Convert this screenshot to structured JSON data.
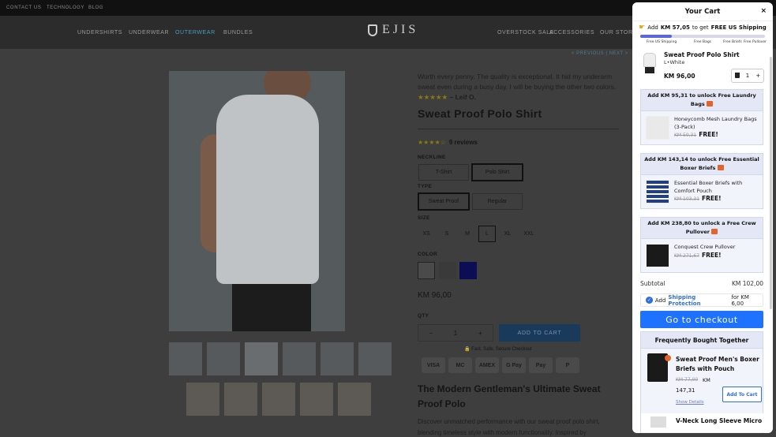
{
  "topbar": {
    "links": [
      "CONTACT US",
      "TECHNOLOGY",
      "BLOG"
    ]
  },
  "nav": {
    "left": [
      "UNDERSHIRTS",
      "UNDERWEAR",
      "OUTERWEAR",
      "BUNDLES"
    ],
    "logo": "EJIS",
    "right": [
      "OVERSTOCK SALE",
      "ACCESSORIES",
      "OUR STORY"
    ]
  },
  "pager": "< PREVIOUS | NEXT >",
  "review": {
    "text": "Worth every penny. The quality is exceptional. It hid my underarm sweat even during a busy day. I will be buying the other two colors.",
    "stars": "★★★★★",
    "author": "– Leif O."
  },
  "product": {
    "title": "Sweat Proof Polo Shirt",
    "rating_stars": "★★★★☆",
    "reviews": "9 reviews",
    "neckline_label": "NECKLINE",
    "neckline": [
      "T-Shirt",
      "Polo Shirt"
    ],
    "type_label": "TYPE",
    "type": [
      "Sweat Proof",
      "Regular"
    ],
    "size_label": "SIZE",
    "sizes": [
      "XS",
      "S",
      "M",
      "L",
      "XL",
      "XXL"
    ],
    "color_label": "COLOR",
    "colors": [
      "#e8e8e8",
      "#555555",
      "#10138a"
    ],
    "price": "KM 96,00",
    "qty_label": "QTY",
    "qty": "1",
    "qty_minus": "−",
    "qty_plus": "+",
    "add_to_cart": "ADD TO CART",
    "secure": "Fast, Safe, Secure Checkout",
    "payments": [
      "VISA",
      "MC",
      "AMEX",
      "G Pay",
      "Pay",
      "P"
    ],
    "subtitle": "The Modern Gentleman's Ultimate Sweat Proof Polo",
    "desc": "Discover unmatched performance with our sweat proof polo shirt, blending timeless style with modern functionality. Inspired by"
  },
  "cart": {
    "title": "Your Cart",
    "close": "×",
    "ship_pre": "Add",
    "ship_amount": "KM 57,05",
    "ship_mid": "to get",
    "ship_goal": "FREE US Shipping",
    "progress": 0.25,
    "milestones": [
      "Free US Shipping",
      "Free Bags",
      "Free Briefs",
      "Free Pullover"
    ],
    "item": {
      "name": "Sweat Proof Polo Shirt",
      "variant": "L•White",
      "price": "KM 96,00",
      "qty": "1",
      "plus": "+"
    },
    "upsells": [
      {
        "header": "Add KM 95,31 to unlock Free Laundry Bags",
        "name": "Honeycomb Mesh Laundry Bags (3-Pack)",
        "old": "KM 59,31",
        "free": "FREE!"
      },
      {
        "header": "Add KM 143,14 to unlock Free Essential Boxer Briefs",
        "name": "Essential Boxer Briefs with Comfort Pouch",
        "old": "KM 103,31",
        "free": "FREE!"
      },
      {
        "header": "Add KM 238,80 to unlock a Free Crew Pullover",
        "name": "Conquest Crew Pullover",
        "old": "KM 271,67",
        "free": "FREE!"
      }
    ],
    "subtotal_label": "Subtotal",
    "subtotal": "KM 102,00",
    "protect_pre": "Add",
    "protect_link": "Shipping Protection",
    "protect_post": "for KM 6,00",
    "checkout": "Go to checkout",
    "fbt_title": "Frequently Bought Together",
    "fbt": {
      "name": "Sweat Proof Men's Boxer Briefs with Pouch",
      "old": "KM 77,00",
      "cur": "KM",
      "new": "147,31",
      "details": "Show Details",
      "add": "Add To Cart"
    },
    "fbt2_name": "V-Neck Long Sleeve Micro"
  }
}
